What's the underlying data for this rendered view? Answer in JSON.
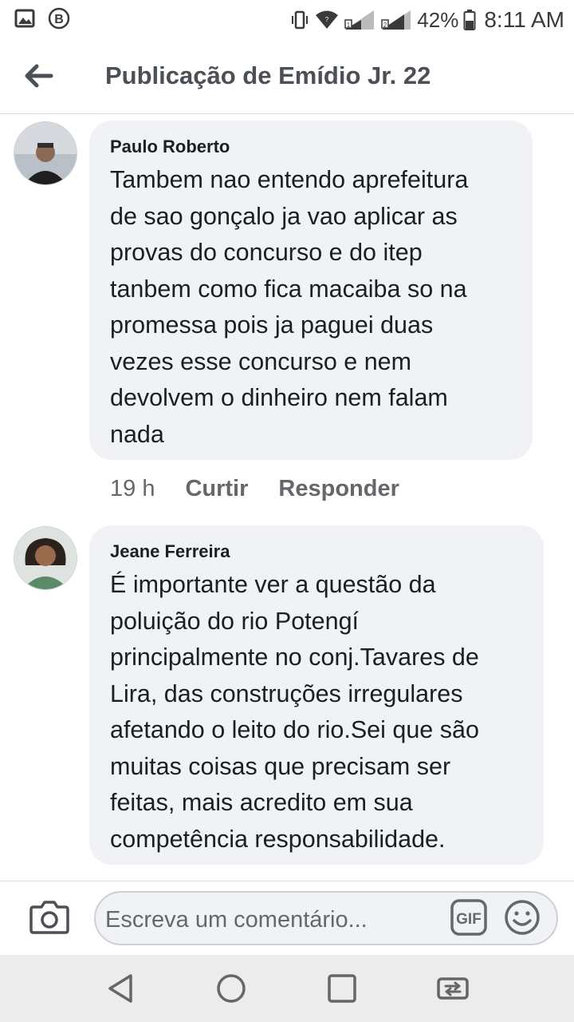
{
  "status_bar": {
    "battery": "42%",
    "time": "8:11 AM"
  },
  "header": {
    "title": "Publicação de Emídio Jr. 22"
  },
  "comments": [
    {
      "author": "Paulo Roberto",
      "text": "Tambem nao entendo aprefeitura\nde sao gonçalo ja vao aplicar as\nprovas do concurso e do itep\ntanbem como fica macaiba so na\npromessa pois ja paguei duas\nvezes esse concurso e nem\ndevolvem o dinheiro nem falam\nnada",
      "time": "19 h",
      "like_label": "Curtir",
      "reply_label": "Responder"
    },
    {
      "author": "Jeane Ferreira",
      "text": "É importante ver a questão da\npoluição do rio Potengí\nprincipalmente no conj.Tavares de\nLira, das construções irregulares\nafetando o leito do rio.Sei que são\nmuitas coisas que precisam ser\nfeitas, mais acredito em sua\ncompetência responsabilidade."
    }
  ],
  "composer": {
    "placeholder": "Escreva um comentário...",
    "gif_label": "GIF"
  },
  "icons": {
    "status_left": [
      "image-icon",
      "b-badge-icon"
    ],
    "status_right": [
      "vibrate-icon",
      "wifi-icon",
      "signal-sim1-icon",
      "signal-sim2-icon",
      "battery-icon"
    ],
    "nav": [
      "nav-back-icon",
      "nav-home-icon",
      "nav-recents-icon",
      "nav-switch-icon"
    ]
  }
}
